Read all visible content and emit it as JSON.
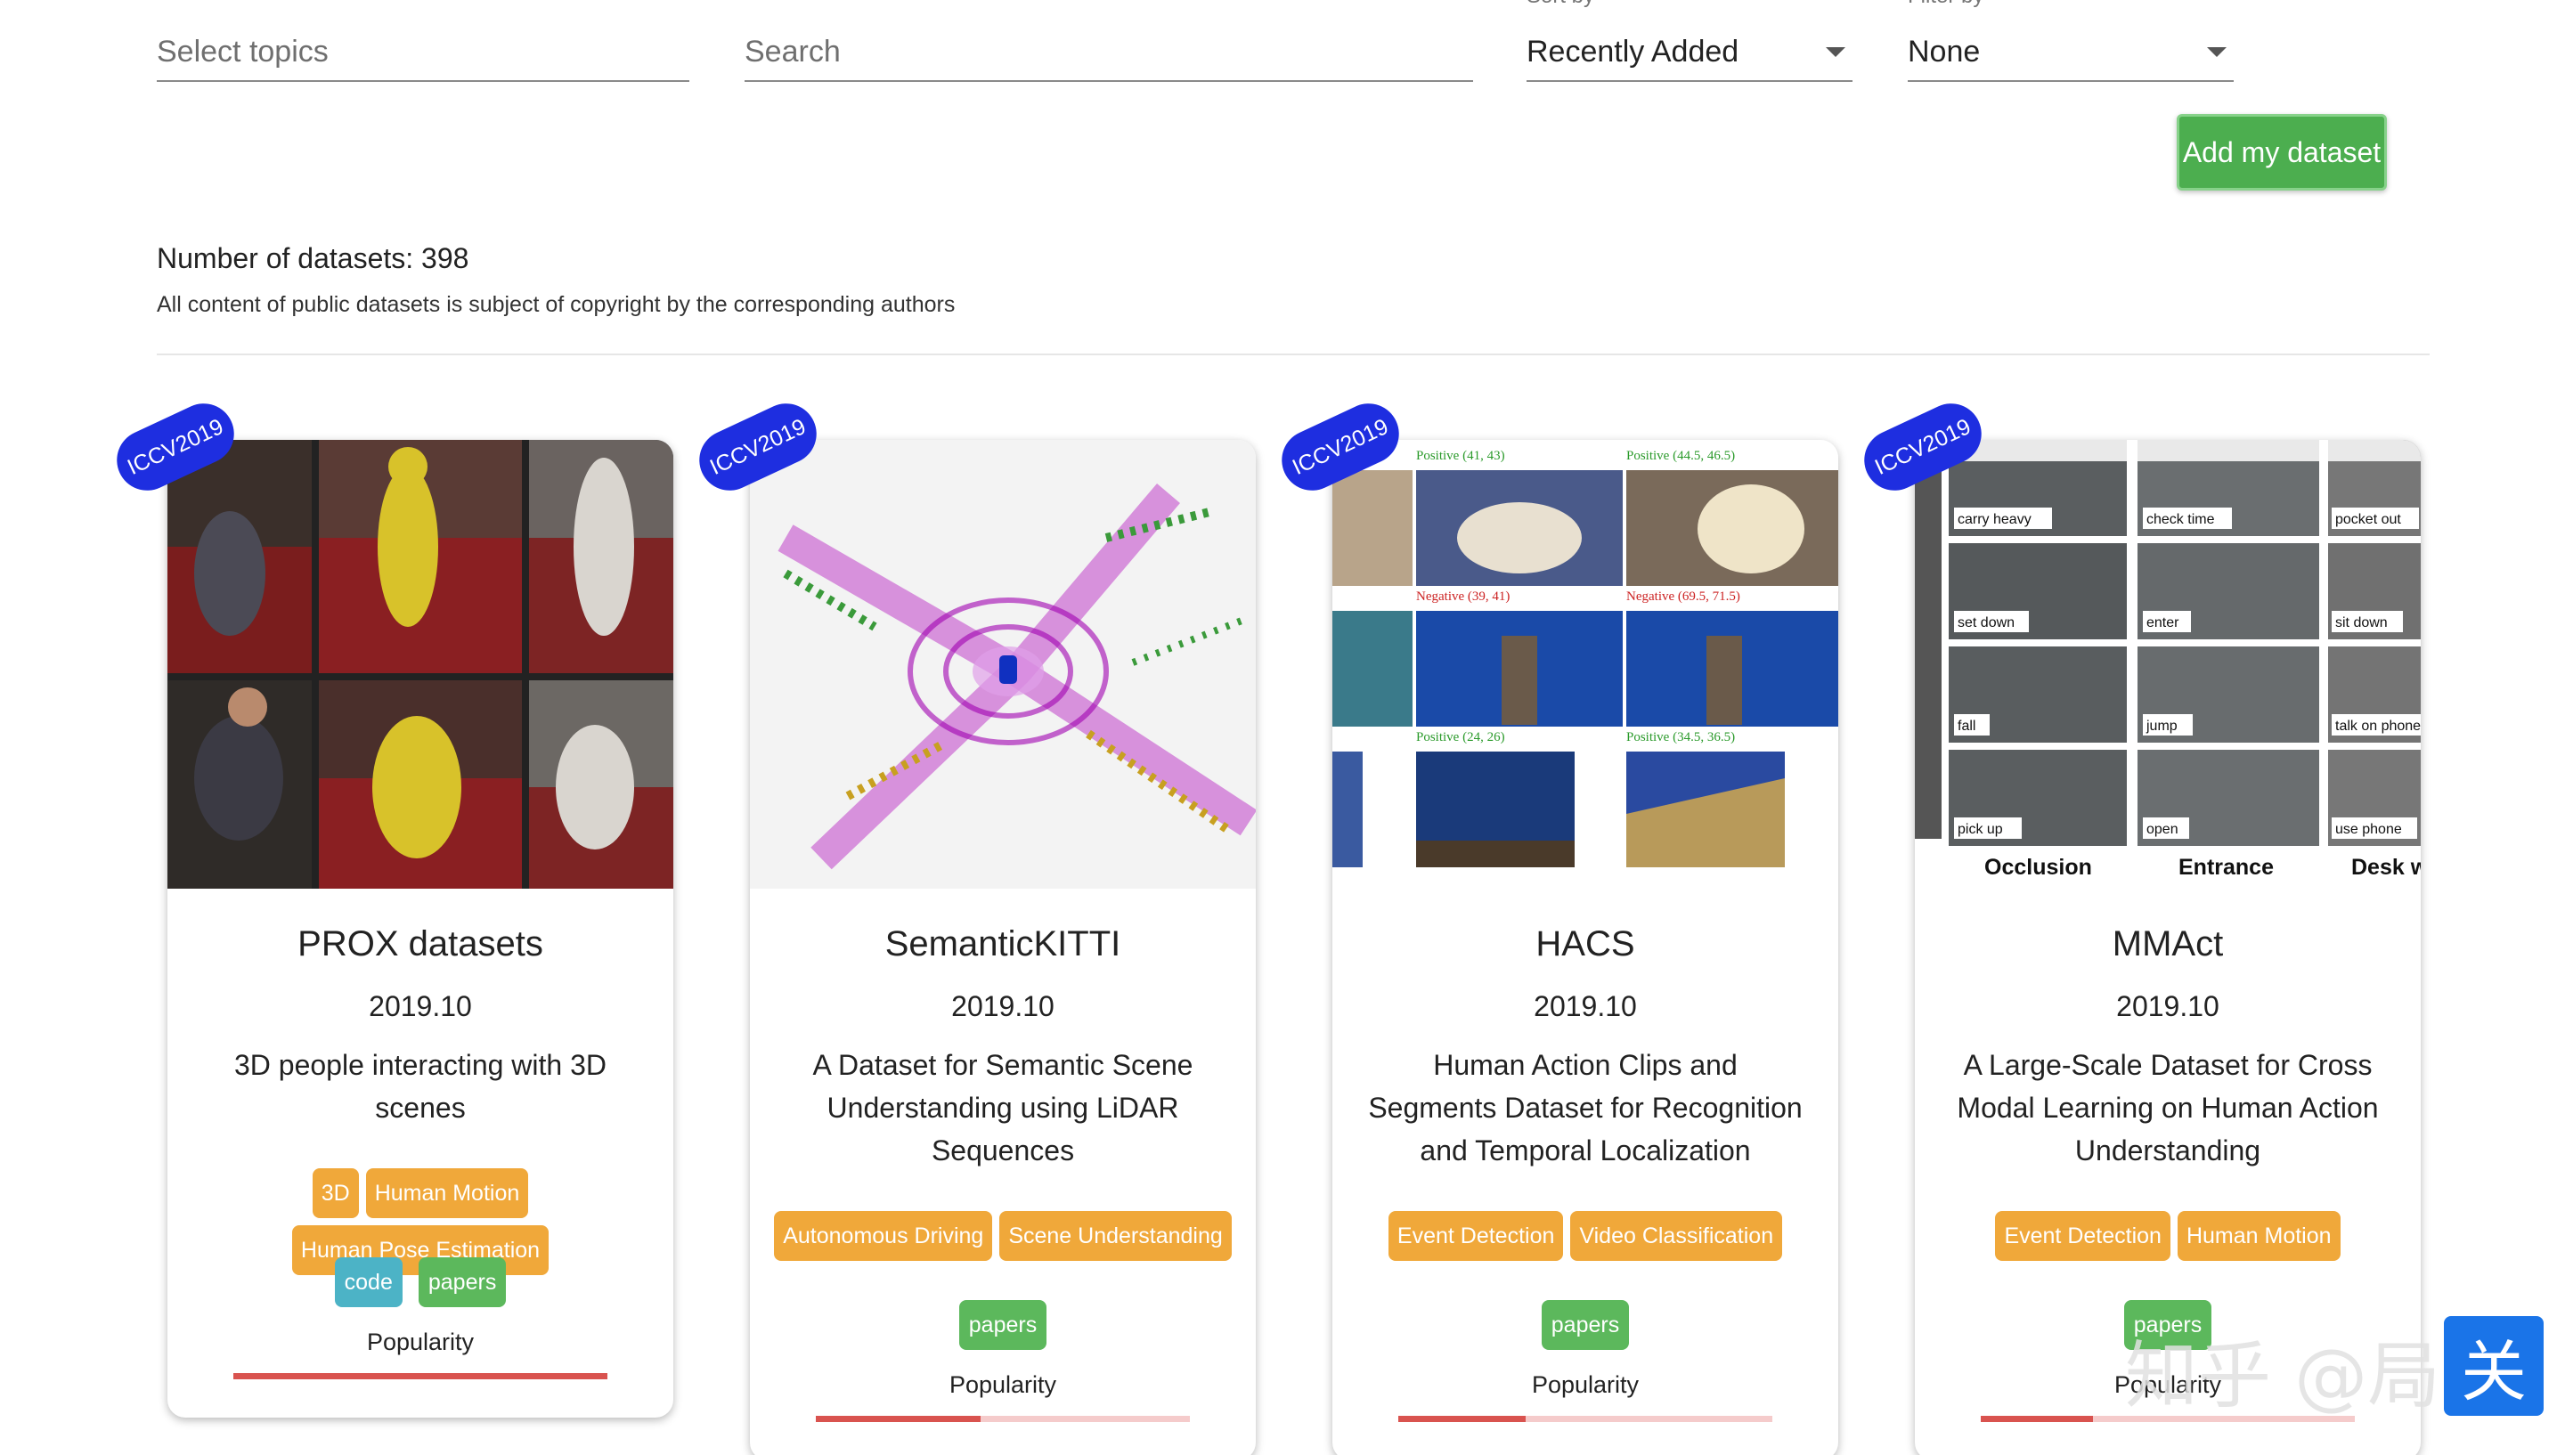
{
  "filters": {
    "topics": {
      "placeholder": "Select topics"
    },
    "search": {
      "placeholder": "Search"
    },
    "sort": {
      "caption": "Sort by",
      "value": "Recently Added"
    },
    "filter": {
      "caption": "Filter by",
      "value": "None"
    }
  },
  "add_button": "Add my dataset",
  "summary": {
    "count": "Number of datasets: 398",
    "copyright": "All content of public datasets is subject of copyright by the corresponding authors"
  },
  "cards": [
    {
      "badge": "ICCV2019",
      "title": "PROX datasets",
      "date": "2019.10",
      "description": "3D people interacting with 3D scenes",
      "tags": [
        "3D",
        "Human Motion",
        "Human Pose Estimation"
      ],
      "links": [
        {
          "label": "code",
          "kind": "code"
        },
        {
          "label": "papers",
          "kind": "papers"
        }
      ],
      "popularity_label": "Popularity",
      "popularity": 1.0
    },
    {
      "badge": "ICCV2019",
      "title": "SemanticKITTI",
      "date": "2019.10",
      "description": "A Dataset for Semantic Scene Understanding using LiDAR Sequences",
      "tags": [
        "Autonomous Driving",
        "Scene Understanding"
      ],
      "links": [
        {
          "label": "papers",
          "kind": "papers"
        }
      ],
      "popularity_label": "Popularity",
      "popularity": 0.44
    },
    {
      "badge": "ICCV2019",
      "title": "HACS",
      "date": "2019.10",
      "description": "Human Action Clips and Segments Dataset for Recognition and Temporal Localization",
      "tags": [
        "Event Detection",
        "Video Classification"
      ],
      "links": [
        {
          "label": "papers",
          "kind": "papers"
        }
      ],
      "popularity_label": "Popularity",
      "popularity": 0.34,
      "image_labels": [
        "Positive (41, 43)",
        "Positive (44.5, 46.5)",
        "Negative (39, 41)",
        "Negative (69.5, 71.5)",
        "Positive (24, 26)",
        "Positive (34.5, 36.5)"
      ]
    },
    {
      "badge": "ICCV2019",
      "title": "MMAct",
      "date": "2019.10",
      "description": "A Large-Scale Dataset for Cross Modal Learning on Human Action Understanding",
      "tags": [
        "Event Detection",
        "Human Motion"
      ],
      "links": [
        {
          "label": "papers",
          "kind": "papers"
        }
      ],
      "popularity_label": "Popularity",
      "popularity": 0.3,
      "image_labels": [
        "carry heavy",
        "check time",
        "pocket out",
        "set down",
        "enter",
        "sit down",
        "fall",
        "jump",
        "talk on phone",
        "pick up",
        "open",
        "use phone"
      ],
      "image_columns": [
        "Occlusion",
        "Entrance",
        "Desk w"
      ]
    }
  ],
  "watermark": {
    "text": "知乎 @局",
    "box": "关"
  }
}
